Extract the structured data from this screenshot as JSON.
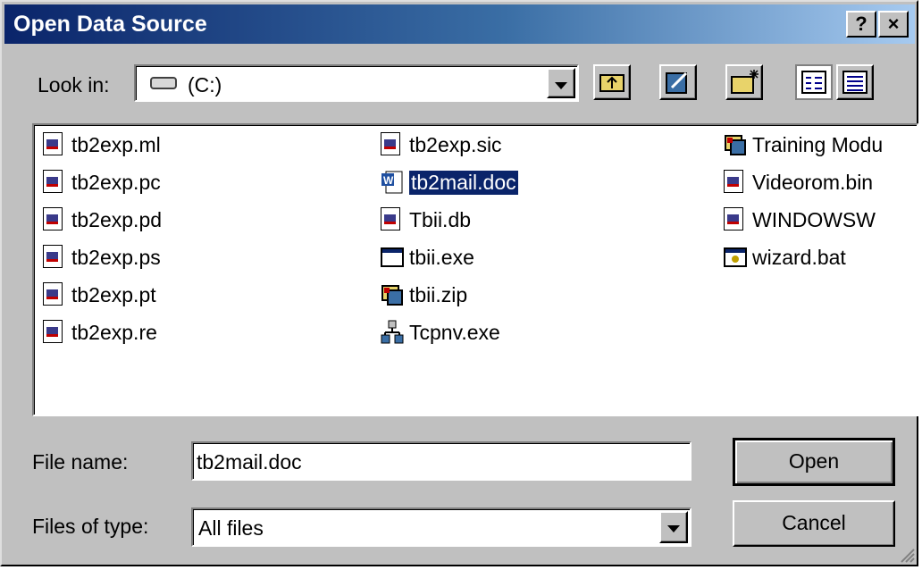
{
  "window": {
    "title": "Open Data Source",
    "help_label": "?",
    "close_label": "×"
  },
  "look_in": {
    "label": "Look in:",
    "value": "(C:)"
  },
  "files": [
    {
      "name": "tb2exp.ml",
      "icon": "document-icon"
    },
    {
      "name": "tb2exp.pc",
      "icon": "document-icon"
    },
    {
      "name": "tb2exp.pd",
      "icon": "document-icon"
    },
    {
      "name": "tb2exp.ps",
      "icon": "document-icon"
    },
    {
      "name": "tb2exp.pt",
      "icon": "document-icon"
    },
    {
      "name": "tb2exp.re",
      "icon": "document-icon"
    },
    {
      "name": "tb2exp.sic",
      "icon": "document-icon"
    },
    {
      "name": "tb2mail.doc",
      "icon": "word-document-icon",
      "selected": true
    },
    {
      "name": "Tbii.db",
      "icon": "document-icon"
    },
    {
      "name": "tbii.exe",
      "icon": "application-icon"
    },
    {
      "name": "tbii.zip",
      "icon": "archive-icon"
    },
    {
      "name": "Tcpnv.exe",
      "icon": "network-icon"
    },
    {
      "name": "Training Modu",
      "icon": "archive-icon"
    },
    {
      "name": "Videorom.bin",
      "icon": "document-icon"
    },
    {
      "name": "WINDOWSW",
      "icon": "document-icon"
    },
    {
      "name": "wizard.bat",
      "icon": "batch-file-icon"
    }
  ],
  "file_name": {
    "label": "File name:",
    "value": "tb2mail.doc"
  },
  "file_type": {
    "label": "Files of type:",
    "value": "All files"
  },
  "buttons": {
    "open": "Open",
    "cancel": "Cancel"
  },
  "colors": {
    "selection": "#0a246a",
    "face": "#c0c0c0"
  }
}
